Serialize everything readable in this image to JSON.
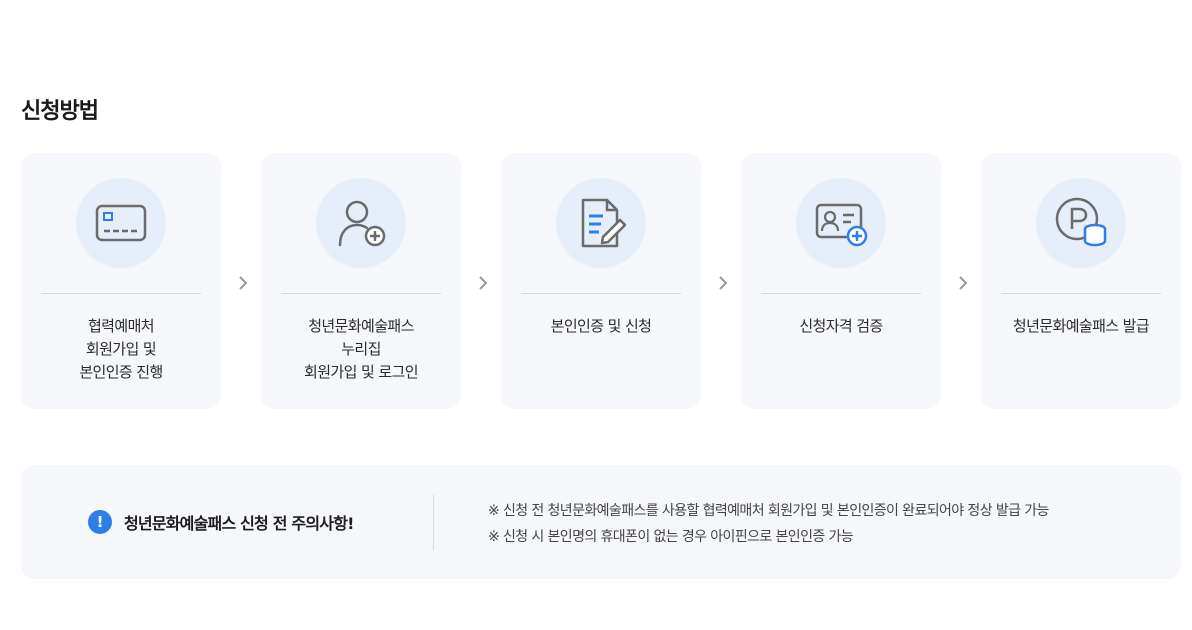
{
  "section": {
    "title": "신청방법"
  },
  "steps": [
    {
      "icon": "credit-card-icon",
      "label": "협력예매처\n회원가입 및\n본인인증 진행"
    },
    {
      "icon": "user-add-icon",
      "label": "청년문화예술패스\n누리집\n회원가입 및 로그인"
    },
    {
      "icon": "document-edit-icon",
      "label": "본인인증 및 신청"
    },
    {
      "icon": "id-card-add-icon",
      "label": "신청자격 검증"
    },
    {
      "icon": "point-coin-icon",
      "label": "청년문화예술패스 발급"
    }
  ],
  "notice": {
    "icon": "exclamation-icon",
    "icon_glyph": "!",
    "title": "청년문화예술패스 신청 전 주의사항!",
    "items": [
      "※ 신청 전 청년문화예술패스를 사용할 협력예매처 회원가입 및 본인인증이 완료되어야 정상 발급 가능",
      "※ 신청 시 본인명의 휴대폰이 없는 경우 아이핀으로 본인인증 가능"
    ]
  },
  "colors": {
    "accent": "#2f7de6",
    "icon_gray": "#6b6b6b",
    "icon_bg": "#e6eefa",
    "card_bg": "#f5f7fa"
  }
}
